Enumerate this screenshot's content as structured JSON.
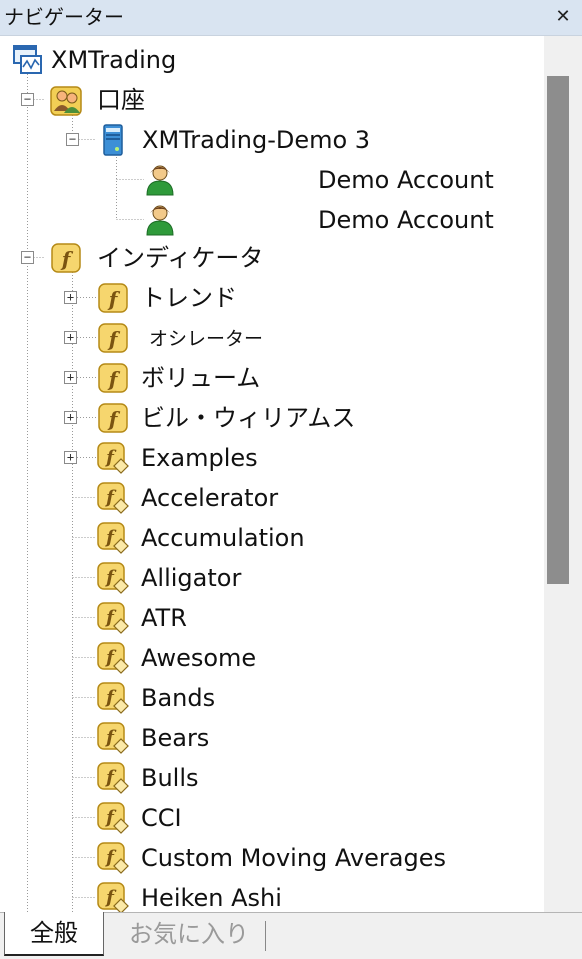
{
  "window": {
    "title": "ナビゲーター",
    "close_label": "✕"
  },
  "tree": {
    "root": {
      "label": "XMTrading",
      "icon": "terminal-icon"
    },
    "accounts": {
      "label": "口座",
      "icon": "accounts-folder-icon",
      "server": {
        "label": "XMTrading-Demo 3",
        "icon": "server-icon"
      },
      "items": [
        {
          "label": "Demo Account",
          "icon": "user-icon"
        },
        {
          "label": "Demo Account",
          "icon": "user-icon"
        }
      ]
    },
    "indicators": {
      "label": "インディケータ",
      "icon": "function-folder-icon",
      "folders": [
        {
          "label": "トレンド",
          "icon": "function-folder-icon"
        },
        {
          "label": "オシレーター",
          "icon": "function-folder-icon"
        },
        {
          "label": "ボリューム",
          "icon": "function-folder-icon"
        },
        {
          "label": "ビル・ウィリアムス",
          "icon": "function-folder-icon"
        },
        {
          "label": "Examples",
          "icon": "indicator-icon"
        }
      ],
      "items": [
        {
          "label": "Accelerator",
          "icon": "indicator-icon"
        },
        {
          "label": "Accumulation",
          "icon": "indicator-icon"
        },
        {
          "label": "Alligator",
          "icon": "indicator-icon"
        },
        {
          "label": "ATR",
          "icon": "indicator-icon"
        },
        {
          "label": "Awesome",
          "icon": "indicator-icon"
        },
        {
          "label": "Bands",
          "icon": "indicator-icon"
        },
        {
          "label": "Bears",
          "icon": "indicator-icon"
        },
        {
          "label": "Bulls",
          "icon": "indicator-icon"
        },
        {
          "label": "CCI",
          "icon": "indicator-icon"
        },
        {
          "label": "Custom Moving Averages",
          "icon": "indicator-icon"
        },
        {
          "label": "Heiken Ashi",
          "icon": "indicator-icon"
        }
      ]
    }
  },
  "tabs": [
    {
      "label": "全般",
      "active": true
    },
    {
      "label": "お気に入り",
      "active": false
    }
  ]
}
